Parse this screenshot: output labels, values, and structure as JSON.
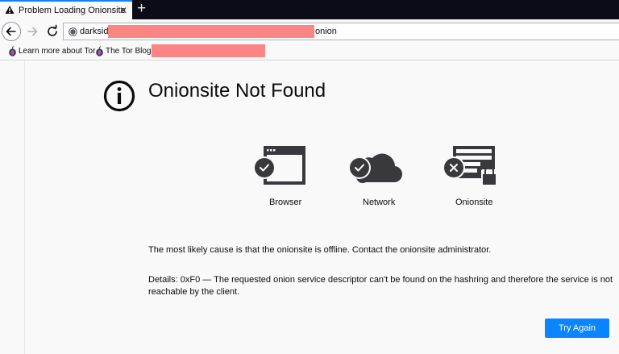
{
  "tab": {
    "title": "Problem Loading Onionsite",
    "close": "✕",
    "new_tab": "+"
  },
  "navbar": {
    "url_visible_prefix": "darksid",
    "url_visible_suffix": "onion"
  },
  "bookmarks": [
    {
      "label": "Learn more about Tor"
    },
    {
      "label": "The Tor Blog"
    }
  ],
  "error": {
    "title": "Onionsite Not Found",
    "diagnostics": [
      {
        "label": "Browser",
        "status": "ok"
      },
      {
        "label": "Network",
        "status": "ok"
      },
      {
        "label": "Onionsite",
        "status": "error"
      }
    ],
    "cause": "The most likely cause is that the onionsite is offline. Contact the onionsite administrator.",
    "details": "Details: 0xF0 — The requested onion service descriptor can't be found on the hashring and therefore the service is not reachable by the client.",
    "button_label": "Try Again"
  },
  "colors": {
    "accent": "#0a84ff",
    "redaction": "#fb8484",
    "tabstrip": "#0c0c16",
    "status_icon": "#38383d"
  }
}
